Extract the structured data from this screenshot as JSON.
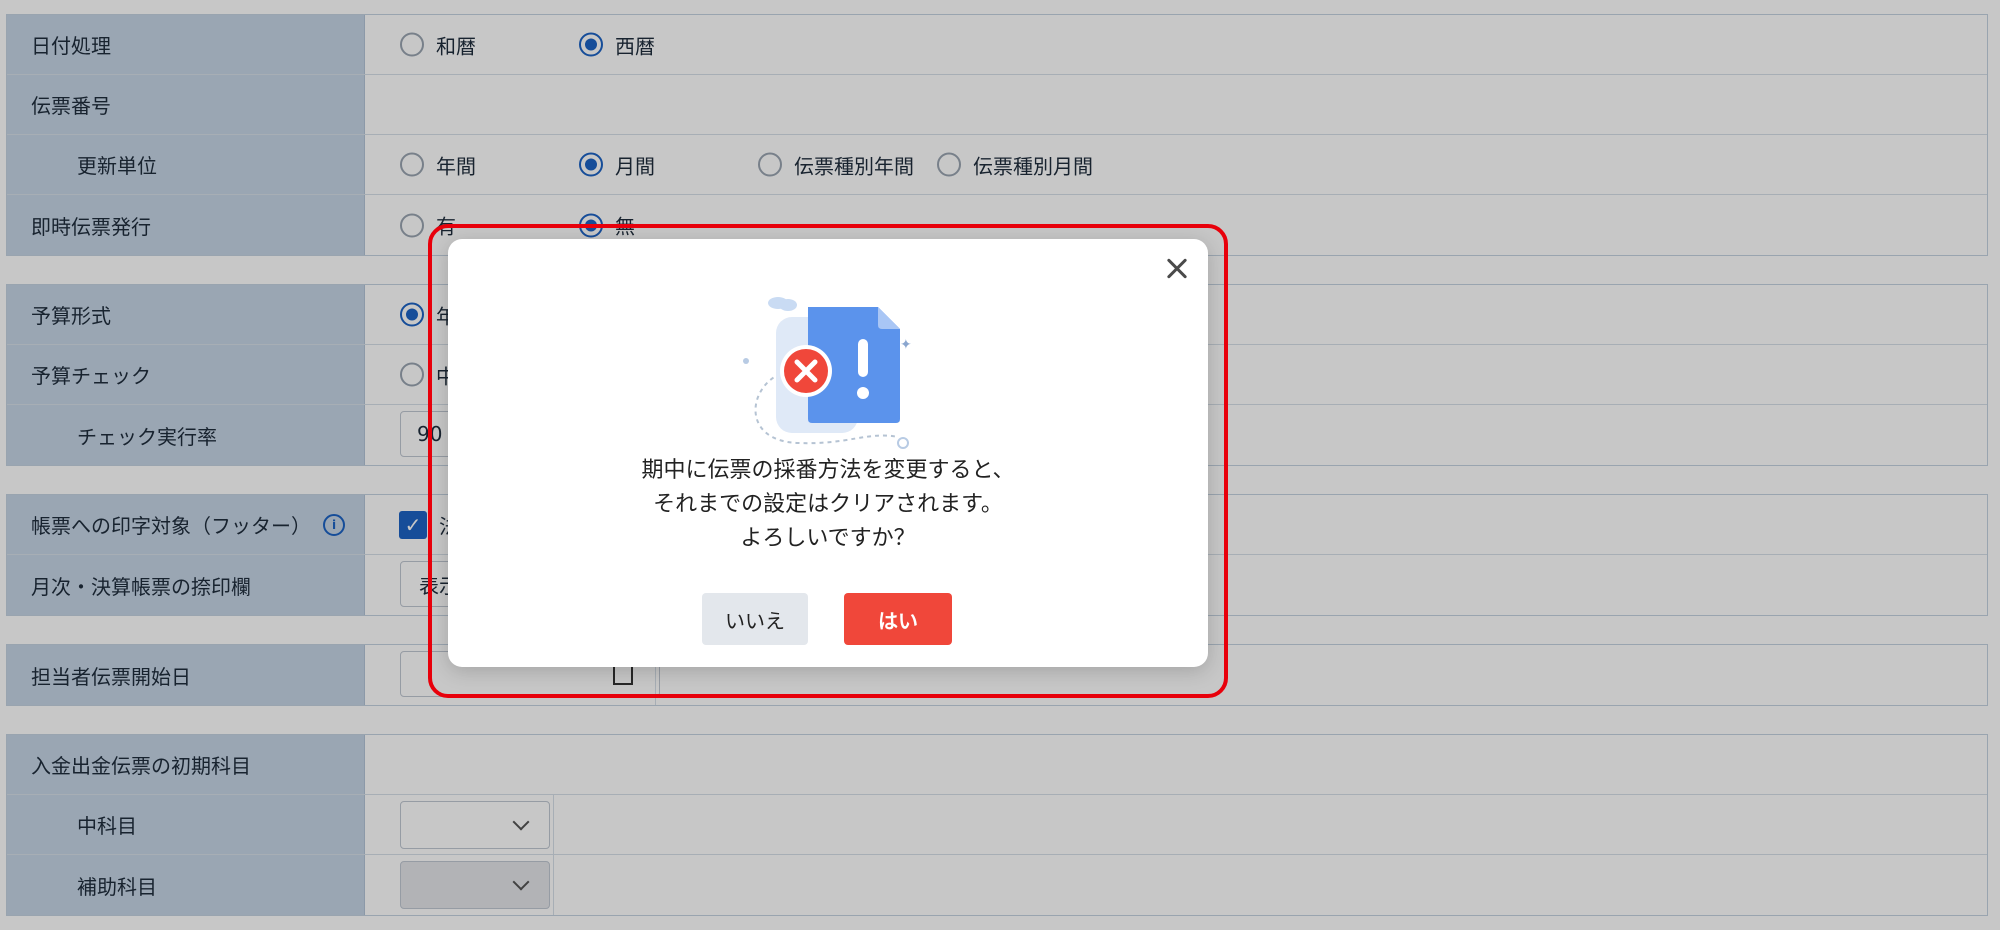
{
  "form": {
    "group1": {
      "date_label": "日付処理",
      "date_opt1": "和暦",
      "date_opt2": "西暦",
      "slip_label": "伝票番号",
      "unit_label": "更新単位",
      "unit_opt1": "年間",
      "unit_opt2": "月間",
      "unit_opt3": "伝票種別年間",
      "unit_opt4": "伝票種別月間",
      "immediate_label": "即時伝票発行",
      "immediate_opt1": "有",
      "immediate_opt2": "無"
    },
    "group2": {
      "budget_form_label": "予算形式",
      "budget_form_opt1": "年",
      "budget_check_label": "予算チェック",
      "budget_check_opt1": "中",
      "check_rate_label": "チェック実行率",
      "check_rate_value": "90"
    },
    "group3": {
      "print_target_label": "帳票への印字対象（フッター）",
      "print_target_checkbox_text": "法",
      "stamp_label": "月次・決算帳票の捺印欄",
      "stamp_value": "表示"
    },
    "group4": {
      "start_date_label": "担当者伝票開始日"
    },
    "group5": {
      "initial_account_label": "入金出金伝票の初期科目",
      "middle_account_label": "中科目",
      "sub_account_label": "補助科目"
    }
  },
  "modal": {
    "message_line1": "期中に伝票の採番方法を変更すると、",
    "message_line2": "それまでの設定はクリアされます。",
    "message_line3": "よろしいですか？",
    "no_label": "いいえ",
    "yes_label": "はい",
    "illustration_icon": "document-error-icon"
  },
  "colors": {
    "label_bg": "#c6d5e6",
    "accent": "#1d63c4",
    "danger": "#f0473a",
    "highlight": "#e8000b"
  }
}
